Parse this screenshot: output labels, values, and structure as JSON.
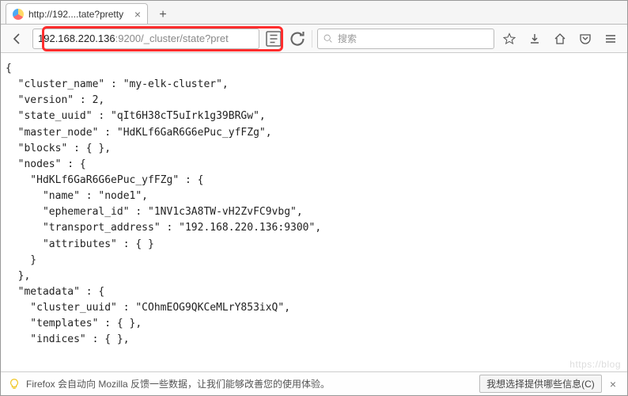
{
  "tab": {
    "title": "http://192....tate?pretty"
  },
  "url": {
    "ip": "192.168.220.136",
    "rest": ":9200/_cluster/state?pret"
  },
  "search": {
    "placeholder": "搜索"
  },
  "json_body": "{\n  \"cluster_name\" : \"my-elk-cluster\",\n  \"version\" : 2,\n  \"state_uuid\" : \"qIt6H38cT5uIrk1g39BRGw\",\n  \"master_node\" : \"HdKLf6GaR6G6ePuc_yfFZg\",\n  \"blocks\" : { },\n  \"nodes\" : {\n    \"HdKLf6GaR6G6ePuc_yfFZg\" : {\n      \"name\" : \"node1\",\n      \"ephemeral_id\" : \"1NV1c3A8TW-vH2ZvFC9vbg\",\n      \"transport_address\" : \"192.168.220.136:9300\",\n      \"attributes\" : { }\n    }\n  },\n  \"metadata\" : {\n    \"cluster_uuid\" : \"COhmEOG9QKCeMLrY853ixQ\",\n    \"templates\" : { },\n    \"indices\" : { },",
  "footer": {
    "msg": "Firefox 会自动向 Mozilla 反馈一些数据，让我们能够改善您的使用体验。",
    "choose": "我想选择提供哪些信息(C)"
  },
  "watermark": "https://blog"
}
